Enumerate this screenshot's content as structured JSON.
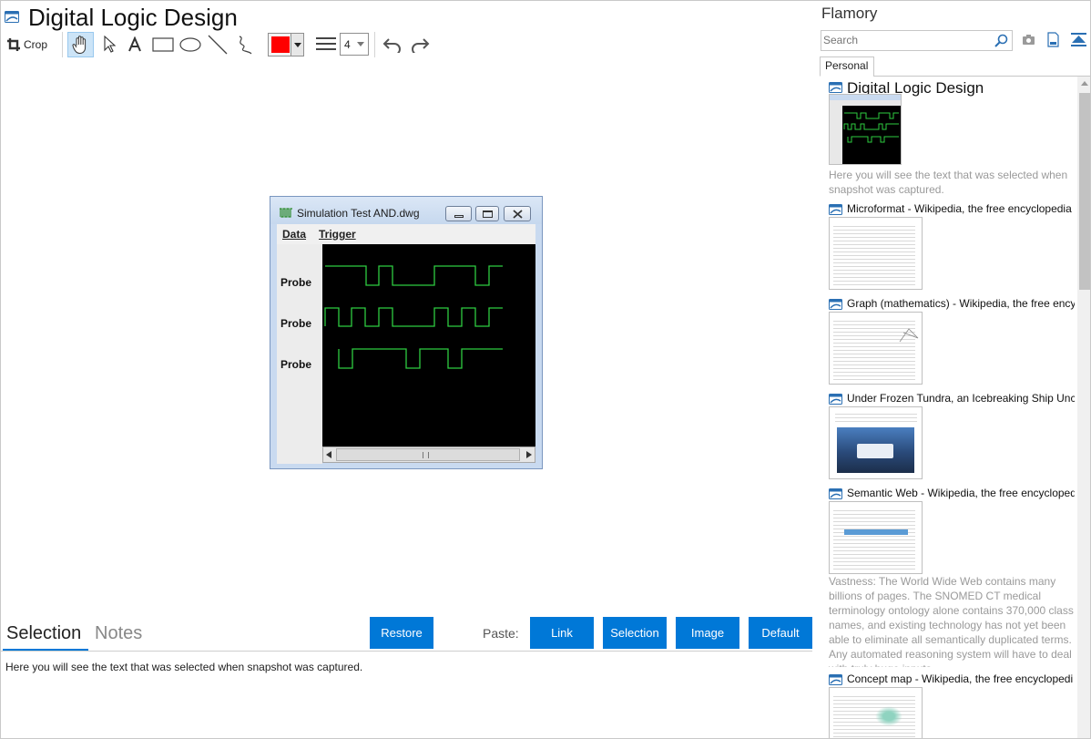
{
  "editor": {
    "title": "Digital Logic Design",
    "toolbar": {
      "crop_label": "Crop",
      "line_width": "4",
      "current_color": "#ff0000"
    }
  },
  "snapshot": {
    "window_title": "Simulation Test AND.dwg",
    "menu": [
      "Data",
      "Trigger"
    ],
    "probe_labels": [
      "Probe",
      "Probe",
      "Probe"
    ],
    "trace_color": "#2ecc40"
  },
  "bottom_pane": {
    "tabs": [
      "Selection",
      "Notes"
    ],
    "restore_label": "Restore",
    "paste_label": "Paste:",
    "paste_buttons": [
      "Link",
      "Selection",
      "Image",
      "Default"
    ],
    "selection_text": "Here you will see the text that was selected when snapshot was captured."
  },
  "sidebar": {
    "app_name": "Flamory",
    "search_placeholder": "Search",
    "tab": "Personal",
    "items": [
      {
        "title": "Digital Logic Design",
        "description": "Here you will see the text that was selected when snapshot was captured."
      },
      {
        "title": "Microformat - Wikipedia, the free encyclopedia"
      },
      {
        "title": "Graph (mathematics) - Wikipedia, the free ency"
      },
      {
        "title": "Under Frozen Tundra, an Icebreaking Ship Unco"
      },
      {
        "title": "Semantic Web - Wikipedia, the free encycloped",
        "description": "Vastness: The World Wide Web contains many billions of pages. The SNOMED CT medical terminology ontology alone contains 370,000 class names, and existing technology has not yet been able to eliminate all semantically duplicated terms. Any automated reasoning system will have to deal with truly huge inputs."
      },
      {
        "title": "Concept map - Wikipedia, the free encyclopedi"
      }
    ]
  },
  "colors": {
    "accent": "#0078d7",
    "hover": "#cce4f7"
  }
}
